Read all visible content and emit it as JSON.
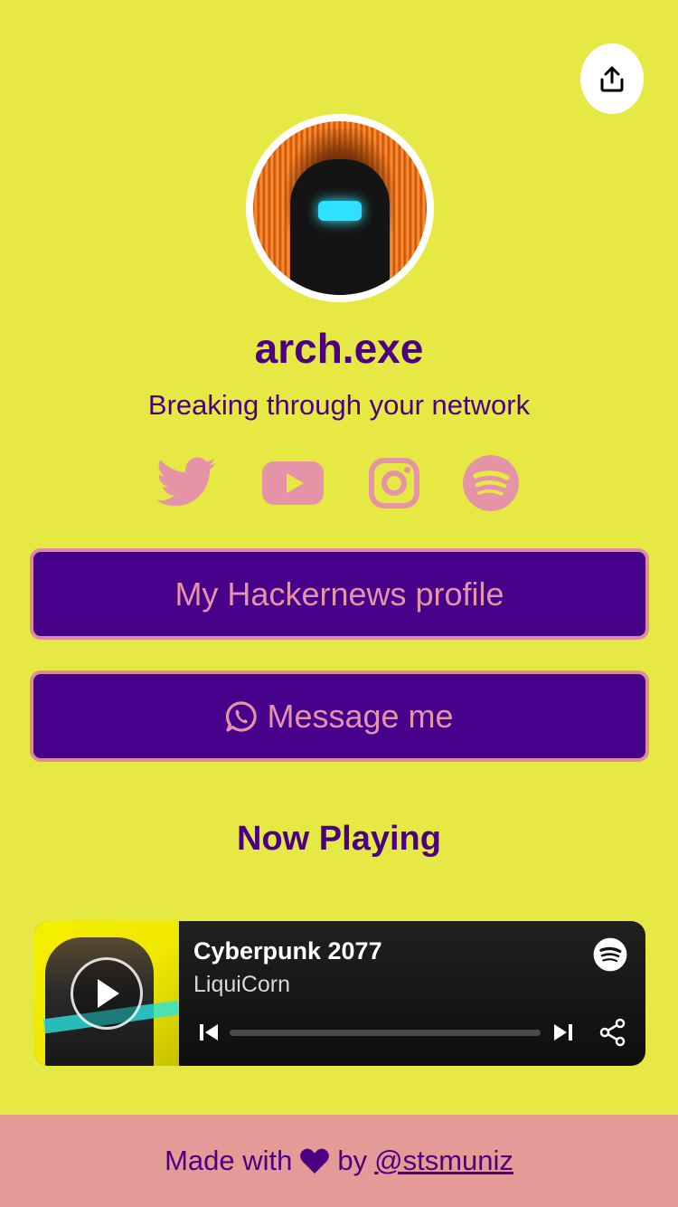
{
  "profile": {
    "name": "arch.exe",
    "bio": "Breaking through your network"
  },
  "socials": [
    {
      "icon": "twitter-icon"
    },
    {
      "icon": "youtube-icon"
    },
    {
      "icon": "instagram-icon"
    },
    {
      "icon": "spotify-icon"
    }
  ],
  "links": {
    "hackernews_label": "My Hackernews profile",
    "message_label": "Message me"
  },
  "now_playing": {
    "section_title": "Now Playing",
    "track_title": "Cyberpunk 2077",
    "artist": "LiquiCorn",
    "progress": 0.0
  },
  "footer": {
    "made_with": "Made with",
    "by": "by",
    "handle": "@stsmuniz"
  },
  "colors": {
    "background": "#e6e843",
    "accent": "#4b0082",
    "button_bg": "#46008a",
    "button_text": "#e594a8",
    "footer_bg": "#e49a96"
  }
}
